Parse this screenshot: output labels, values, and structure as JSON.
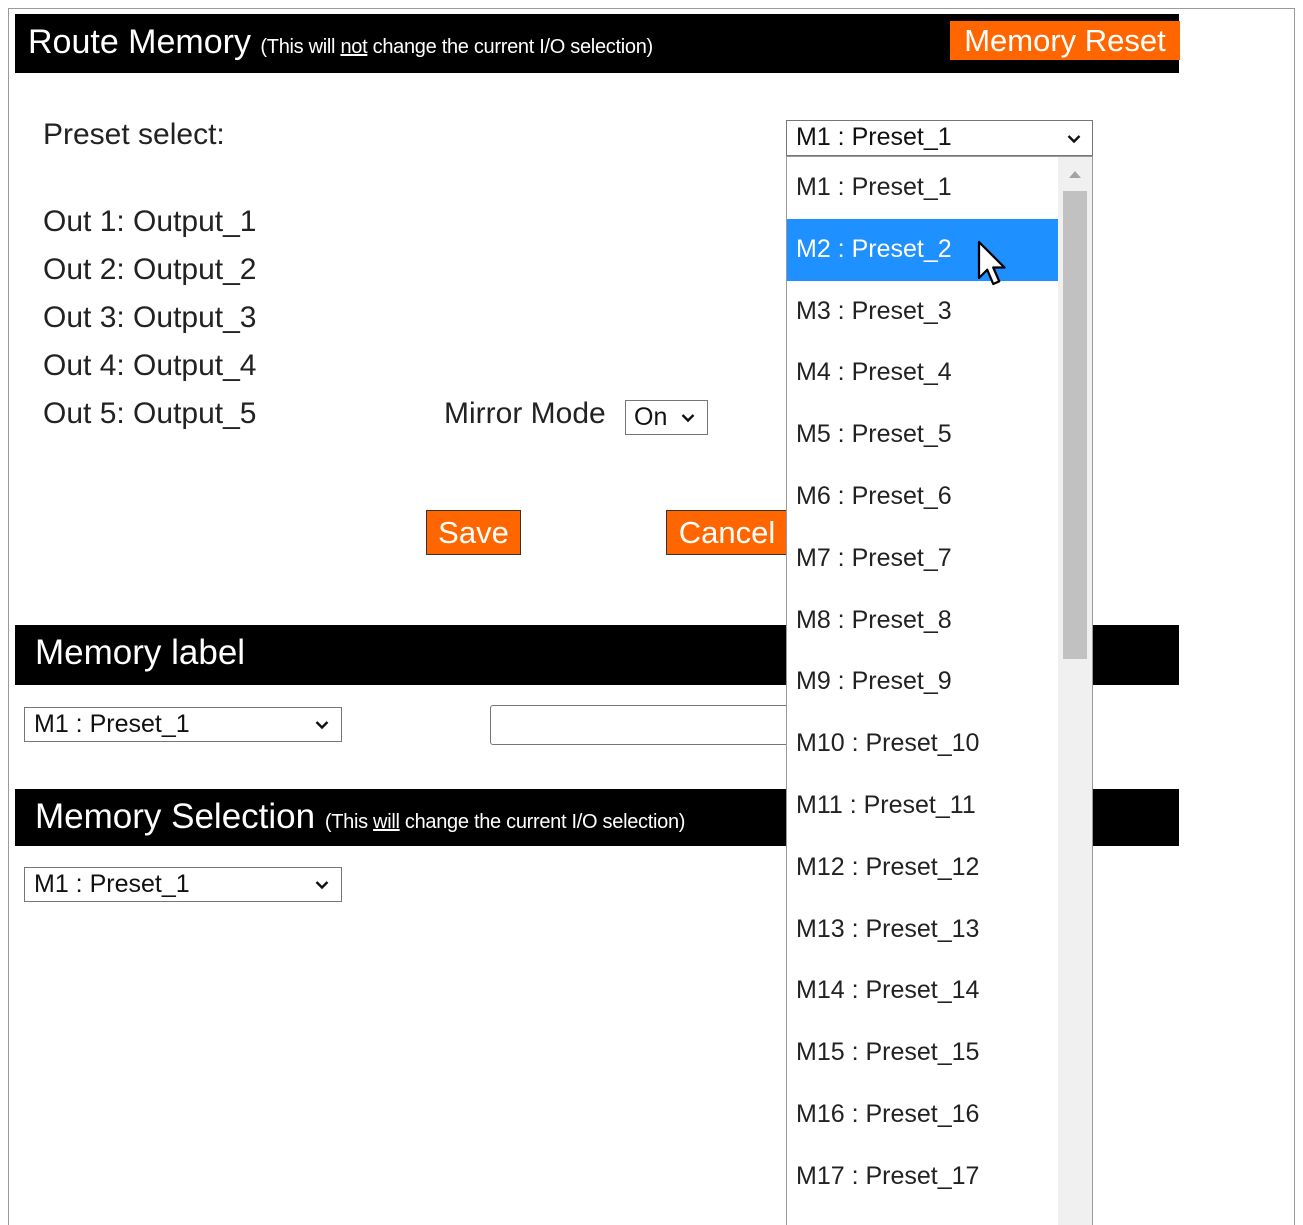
{
  "route_memory": {
    "title": "Route Memory",
    "note_before": "(This will ",
    "note_emphasis": "not",
    "note_after": " change the current I/O selection)",
    "reset_label": "Memory Reset",
    "preset_label": "Preset select:",
    "preset_value": "M1 : Preset_1",
    "outputs": [
      "Out 1: Output_1",
      "Out 2: Output_2",
      "Out 3: Output_3",
      "Out 4: Output_4",
      "Out 5: Output_5"
    ],
    "mirror_label": "Mirror Mode",
    "mirror_value": "On",
    "save_label": "Save",
    "cancel_label": "Cancel"
  },
  "memory_label": {
    "title": "Memory label",
    "select_value": "M1 : Preset_1",
    "input_value": ""
  },
  "memory_selection": {
    "title": "Memory Selection",
    "note_before": "(This ",
    "note_emphasis": "will",
    "note_after": " change the current I/O selection)",
    "select_value": "M1 : Preset_1"
  },
  "dropdown": {
    "selected_index": 1,
    "options": [
      "M1 : Preset_1",
      "M2 : Preset_2",
      "M3 : Preset_3",
      "M4 : Preset_4",
      "M5 : Preset_5",
      "M6 : Preset_6",
      "M7 : Preset_7",
      "M8 : Preset_8",
      "M9 : Preset_9",
      "M10 : Preset_10",
      "M11 : Preset_11",
      "M12 : Preset_12",
      "M13 : Preset_13",
      "M14 : Preset_14",
      "M15 : Preset_15",
      "M16 : Preset_16",
      "M17 : Preset_17"
    ]
  },
  "colors": {
    "accent": "#ff6600",
    "header_bg": "#000000",
    "highlight": "#1e90ff"
  }
}
